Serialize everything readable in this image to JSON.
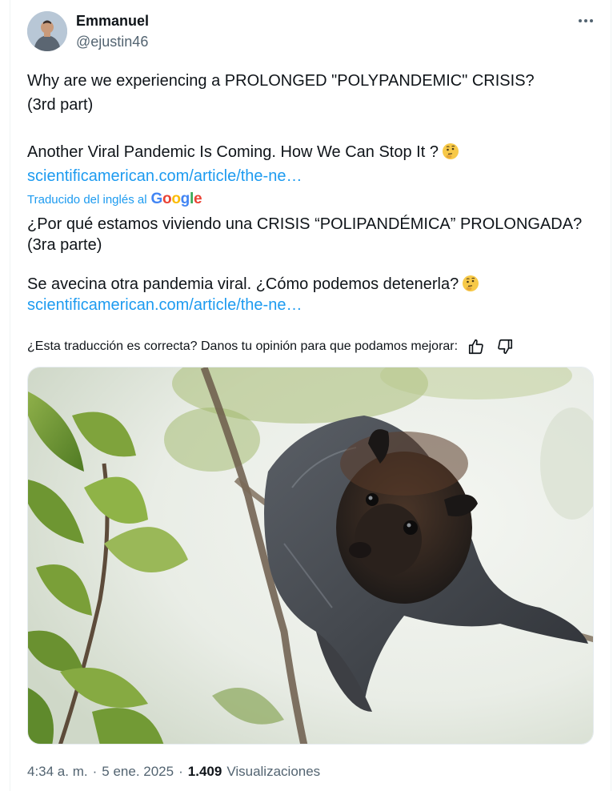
{
  "author": {
    "name": "Emmanuel",
    "handle": "@ejustin46",
    "avatar_icon": "user-avatar-photo"
  },
  "more_icon": "more-dots-icon",
  "original_text": {
    "line1": "Why are we experiencing a PROLONGED \"POLYPANDEMIC\" CRISIS?",
    "line2": "(3rd part)",
    "line3": "Another Viral Pandemic Is Coming. How We Can Stop It ?",
    "link": "scientificamerican.com/article/the-ne…"
  },
  "translation": {
    "label": "Traducido del inglés al",
    "provider": "Google",
    "line1": "¿Por qué estamos viviendo una CRISIS “POLIPANDÉMICA” PROLONGADA?",
    "line2": "(3ra parte)",
    "line3": "Se avecina otra pandemia viral. ¿Cómo podemos detenerla?",
    "link": "scientificamerican.com/article/the-ne…"
  },
  "feedback": {
    "question": "¿Esta traducción es correcta? Danos tu opinión para que podamos mejorar:",
    "thumbs_up_icon": "thumbs-up-icon",
    "thumbs_down_icon": "thumbs-down-icon"
  },
  "media": {
    "subject": "fruit bat hanging among leaves"
  },
  "meta": {
    "time": "4:34 a. m.",
    "separator1": "·",
    "date": "5 ene. 2025",
    "separator2": "·",
    "views_count": "1.409",
    "views_label": "Visualizaciones"
  },
  "colors": {
    "link": "#1d9bf0",
    "secondary": "#536471",
    "text": "#0f1419"
  }
}
